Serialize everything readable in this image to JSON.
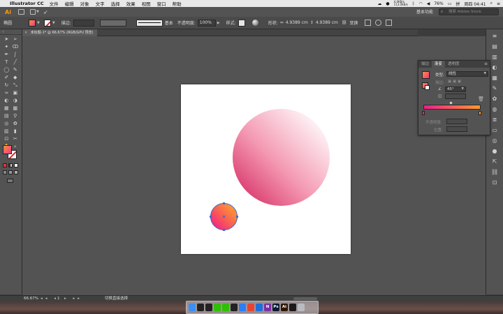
{
  "menubar": {
    "app_name": "Illustrator CC",
    "items": [
      "文件",
      "编辑",
      "对象",
      "文字",
      "选择",
      "效果",
      "视图",
      "窗口",
      "帮助"
    ],
    "net_up": "4.0KB/s",
    "net_down": "113.0KB/s",
    "battery": "76%",
    "clock": "周四 04:41"
  },
  "appbar": {
    "logo": "Ai",
    "workspace": "基本功能",
    "search_placeholder": "搜索 Adobe Stock"
  },
  "controlbar": {
    "selection_label": "椭圆",
    "stroke_label": "描边:",
    "line_label": "基本",
    "opacity_label": "不透明度:",
    "opacity_value": "100%",
    "style_label": "样式:",
    "shape_label": "形状:",
    "width_value": "4.9389 cm",
    "height_value": "4.9389 cm",
    "transform_label": "变换"
  },
  "document": {
    "tab_title": "未标题-1* @ 66.67% (RGB/GPU 预览)"
  },
  "gradient_panel": {
    "tabs": [
      "描边",
      "渐变",
      "透明度"
    ],
    "type_label": "类型:",
    "type_value": "线性",
    "stroke_label": "描边:",
    "angle_value": "45°",
    "opacity_label": "不透明度:",
    "location_label": "位置:",
    "colors": {
      "start": "#ee1e8a",
      "end": "#ff9a2a"
    }
  },
  "statusbar": {
    "zoom": "66.67%",
    "page": "1",
    "message": "切换直接选择"
  },
  "dock": {
    "apps": [
      {
        "name": "finder",
        "label": "",
        "color": "#3b8ff0"
      },
      {
        "name": "qq",
        "label": "",
        "color": "#222222"
      },
      {
        "name": "qq-2",
        "label": "",
        "color": "#222222"
      },
      {
        "name": "wechat",
        "label": "",
        "color": "#2dc100"
      },
      {
        "name": "wechat-2",
        "label": "",
        "color": "#2dc100"
      },
      {
        "name": "qq-3",
        "label": "",
        "color": "#222222"
      },
      {
        "name": "safari",
        "label": "",
        "color": "#2e7cf6"
      },
      {
        "name": "chrome",
        "label": "",
        "color": "#e94235"
      },
      {
        "name": "app-9",
        "label": "",
        "color": "#1e6fd9"
      },
      {
        "name": "onenote",
        "label": "N",
        "color": "#7b2fa5"
      },
      {
        "name": "photoshop",
        "label": "Ps",
        "color": "#0a1a33"
      },
      {
        "name": "illustrator",
        "label": "Ai",
        "color": "#2d1600"
      },
      {
        "name": "terminal",
        "label": "",
        "color": "#1a1a1a"
      },
      {
        "name": "trash",
        "label": "",
        "color": "#b8bcc2"
      }
    ]
  }
}
